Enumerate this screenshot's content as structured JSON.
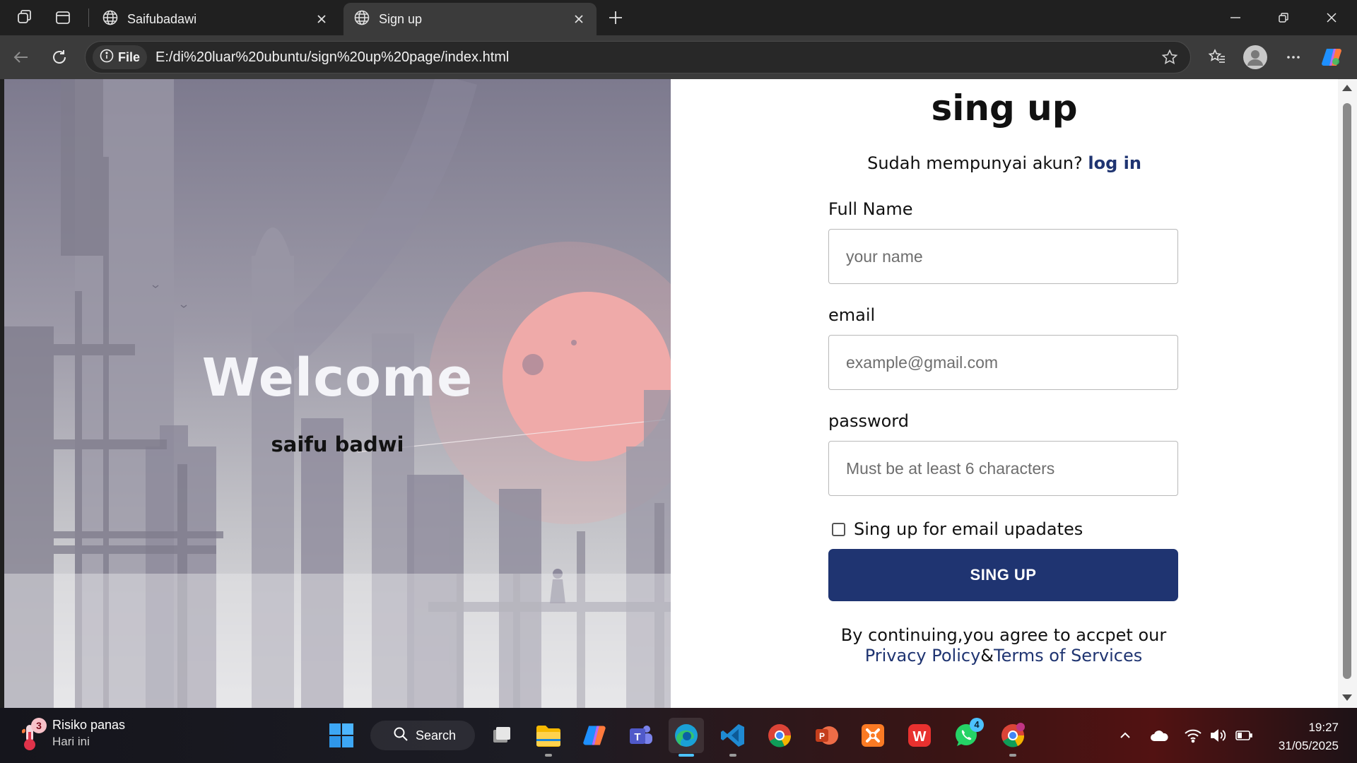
{
  "browser": {
    "tabs": [
      {
        "title": "Saifubadawi",
        "active": false
      },
      {
        "title": "Sign up",
        "active": true
      }
    ],
    "address": {
      "site_info_label": "File",
      "url": "E:/di%20luar%20ubuntu/sign%20up%20page/index.html"
    }
  },
  "page": {
    "hero": {
      "title": "Welcome",
      "name": "saifu badwi"
    },
    "form": {
      "title": "sing up",
      "login_prompt": "Sudah mempunyai akun? ",
      "login_link": "log in",
      "full_name_label": "Full Name",
      "full_name_placeholder": "your name",
      "email_label": "email",
      "email_placeholder": "example@gmail.com",
      "password_label": "password",
      "password_placeholder": "Must be at least 6 characters",
      "newsletter_label": "Sing up for email upadates",
      "newsletter_checked": false,
      "submit_label": "SING UP",
      "terms_text": "By continuing,you agree to accpet our",
      "privacy_link": "Privacy Policy",
      "terms_separator": "&",
      "terms_link": "Terms of Services"
    }
  },
  "taskbar": {
    "weather": {
      "badge": "3",
      "title": "Risiko panas",
      "subtitle": "Hari ini"
    },
    "search_label": "Search",
    "apps": [
      {
        "name": "file-explorer"
      },
      {
        "name": "copilot"
      },
      {
        "name": "teams"
      },
      {
        "name": "edge",
        "active": true
      },
      {
        "name": "vscode"
      },
      {
        "name": "chrome"
      },
      {
        "name": "powerpoint"
      },
      {
        "name": "xampp"
      },
      {
        "name": "wps"
      },
      {
        "name": "whatsapp",
        "badge": "4"
      },
      {
        "name": "chrome-profile"
      }
    ],
    "clock": {
      "time": "19:27",
      "date": "31/05/2025"
    }
  },
  "colors": {
    "brand_navy": "#1f3471",
    "taskbar_accent": "#4cc2ff"
  }
}
